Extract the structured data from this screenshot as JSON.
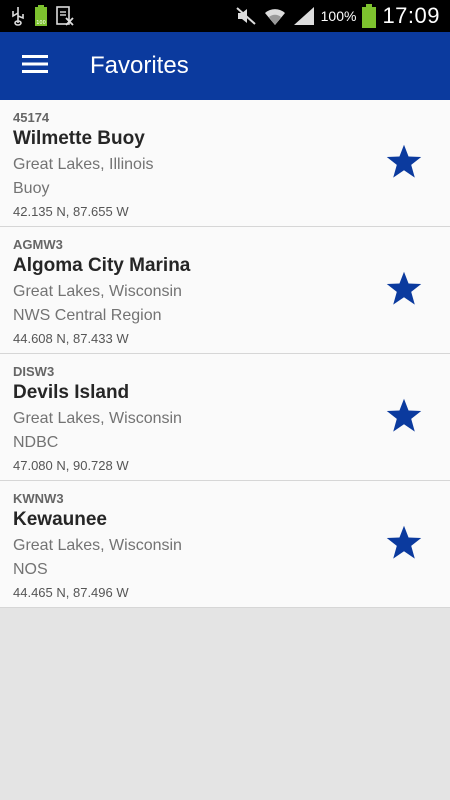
{
  "status_bar": {
    "icons_left": [
      "usb-icon",
      "battery-small-icon",
      "screenshot-icon"
    ],
    "icons_right": [
      "mute-icon",
      "wifi-icon",
      "signal-icon",
      "battery-icon"
    ],
    "battery_percent": "100%",
    "time": "17:09"
  },
  "app_bar": {
    "title": "Favorites",
    "menu_icon": "hamburger-menu-icon"
  },
  "favorites": [
    {
      "code": "45174",
      "name": "Wilmette Buoy",
      "region": "Great Lakes, Illinois",
      "owner": "Buoy",
      "coords": "42.135 N, 87.655 W"
    },
    {
      "code": "AGMW3",
      "name": "Algoma City Marina",
      "region": "Great Lakes, Wisconsin",
      "owner": "NWS Central Region",
      "coords": "44.608 N, 87.433 W"
    },
    {
      "code": "DISW3",
      "name": "Devils Island",
      "region": "Great Lakes, Wisconsin",
      "owner": "NDBC",
      "coords": "47.080 N, 90.728 W"
    },
    {
      "code": "KWNW3",
      "name": "Kewaunee",
      "region": "Great Lakes, Wisconsin",
      "owner": "NOS",
      "coords": "44.465 N, 87.496 W"
    }
  ],
  "colors": {
    "app_bar": "#0b3a9e",
    "star": "#0b3a9e",
    "background": "#e4e4e4",
    "battery_green": "#7dc22e"
  }
}
